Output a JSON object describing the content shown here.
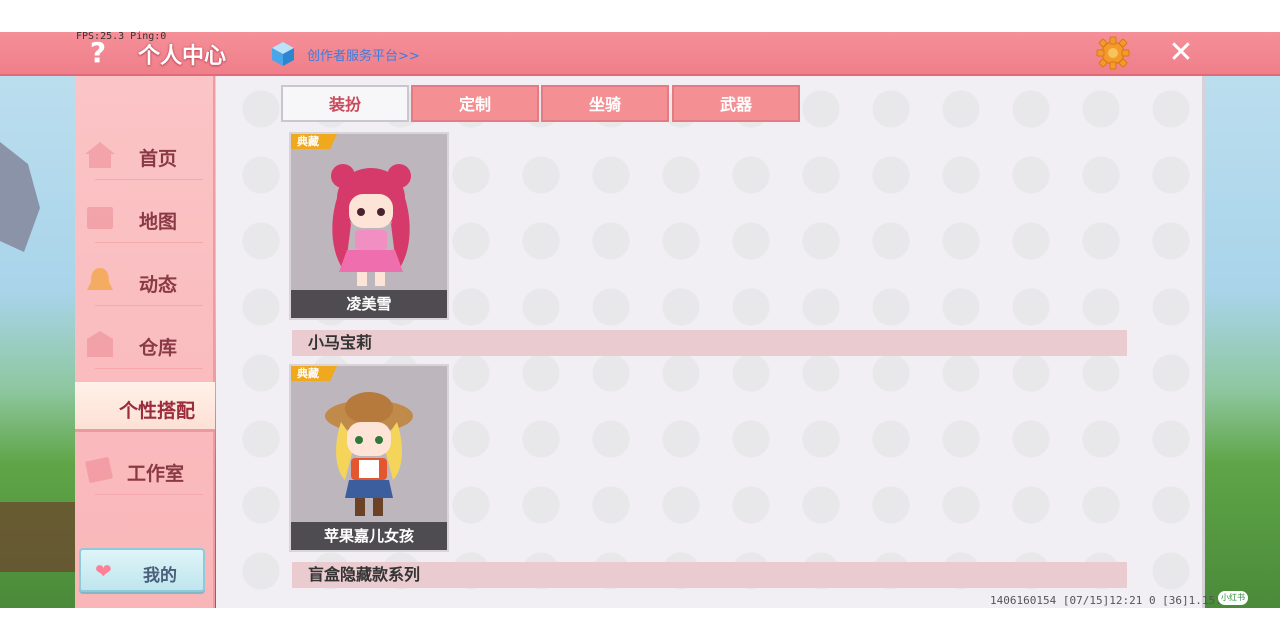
{
  "hud": {
    "fps_text": "FPS:25.3 Ping:0"
  },
  "header": {
    "title": "个人中心",
    "creator_link": "创作者服务平台>>"
  },
  "sidebar": {
    "items": [
      {
        "label": "首页",
        "icon": "home-icon"
      },
      {
        "label": "地图",
        "icon": "map-icon"
      },
      {
        "label": "动态",
        "icon": "bell-icon"
      },
      {
        "label": "仓库",
        "icon": "warehouse-icon"
      },
      {
        "label": "个性搭配",
        "icon": "outfit-icon",
        "active": true
      },
      {
        "label": "工作室",
        "icon": "studio-icon"
      }
    ],
    "my_button": "我的"
  },
  "tabs": [
    {
      "label": "装扮",
      "active": true
    },
    {
      "label": "定制",
      "active": false
    },
    {
      "label": "坐骑",
      "active": false
    },
    {
      "label": "武器",
      "active": false
    }
  ],
  "sections": [
    {
      "badge": "典藏",
      "character_name": "凌美雪",
      "series_name": "小马宝莉"
    },
    {
      "badge": "典藏",
      "character_name": "苹果嘉儿女孩",
      "series_name": "盲盒隐藏款系列"
    }
  ],
  "status_bar": {
    "text": "1406160154  [07/15]12:21 0  [36]1.15.2",
    "watermark": "小红书"
  },
  "colors": {
    "header": "#ef7f8a",
    "sidebar": "#fbc4c6",
    "tab_active_text": "#c94a5a",
    "badge": "#f0a81f"
  }
}
